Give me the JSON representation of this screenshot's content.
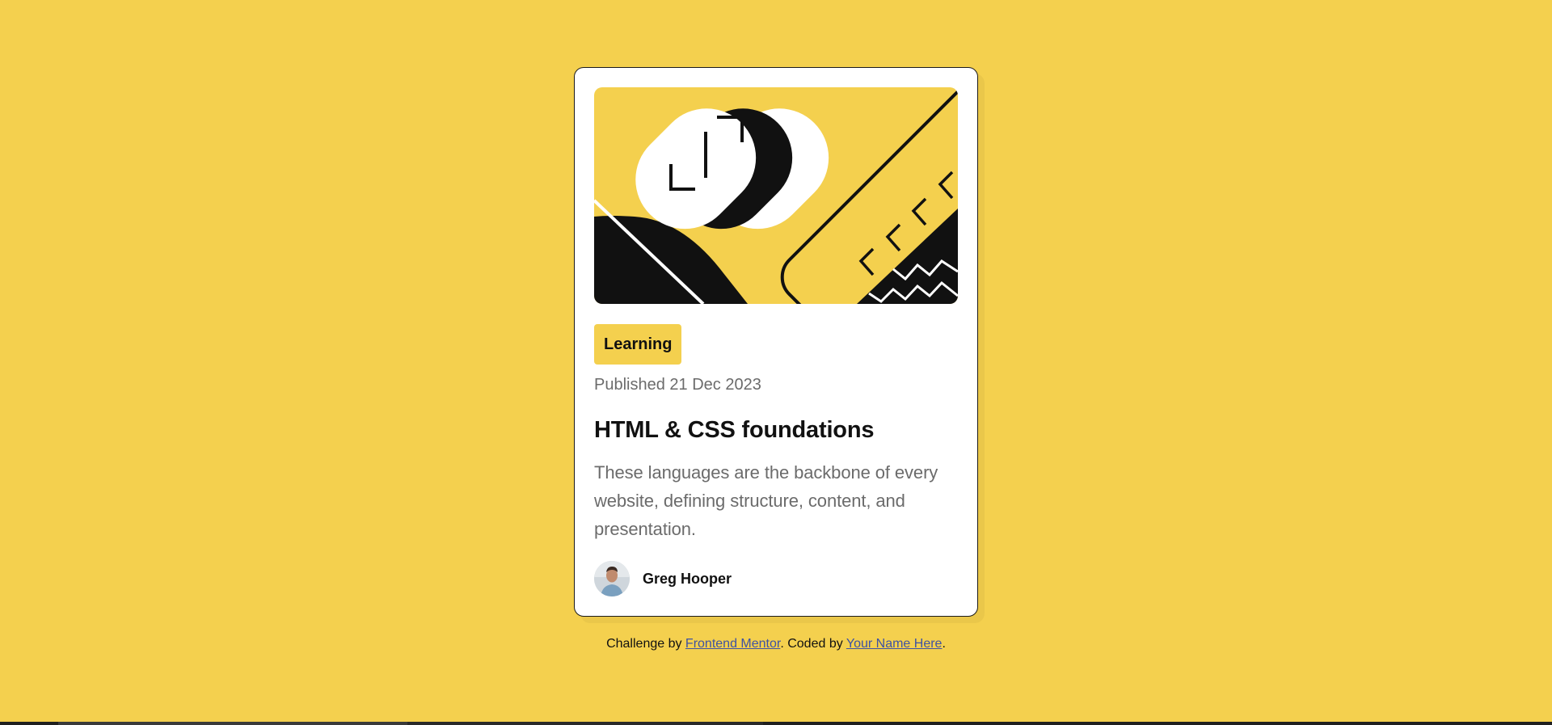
{
  "card": {
    "tag": "Learning",
    "published": "Published 21 Dec 2023",
    "title": "HTML & CSS foundations",
    "description": "These languages are the backbone of every website, defining structure, content, and presentation.",
    "author": {
      "name": "Greg Hooper",
      "avatar_icon": "avatar-icon"
    },
    "illustration_icon": "abstract-illustration"
  },
  "attribution": {
    "prefix": "Challenge by ",
    "link1": "Frontend Mentor",
    "middle": ". Coded by ",
    "link2": "Your Name Here",
    "suffix": "."
  },
  "colors": {
    "background": "#F4D04E",
    "card": "#FFFFFF",
    "text_dark": "#111111",
    "text_gray": "#6B6B6B",
    "link": "#3e52a3"
  }
}
